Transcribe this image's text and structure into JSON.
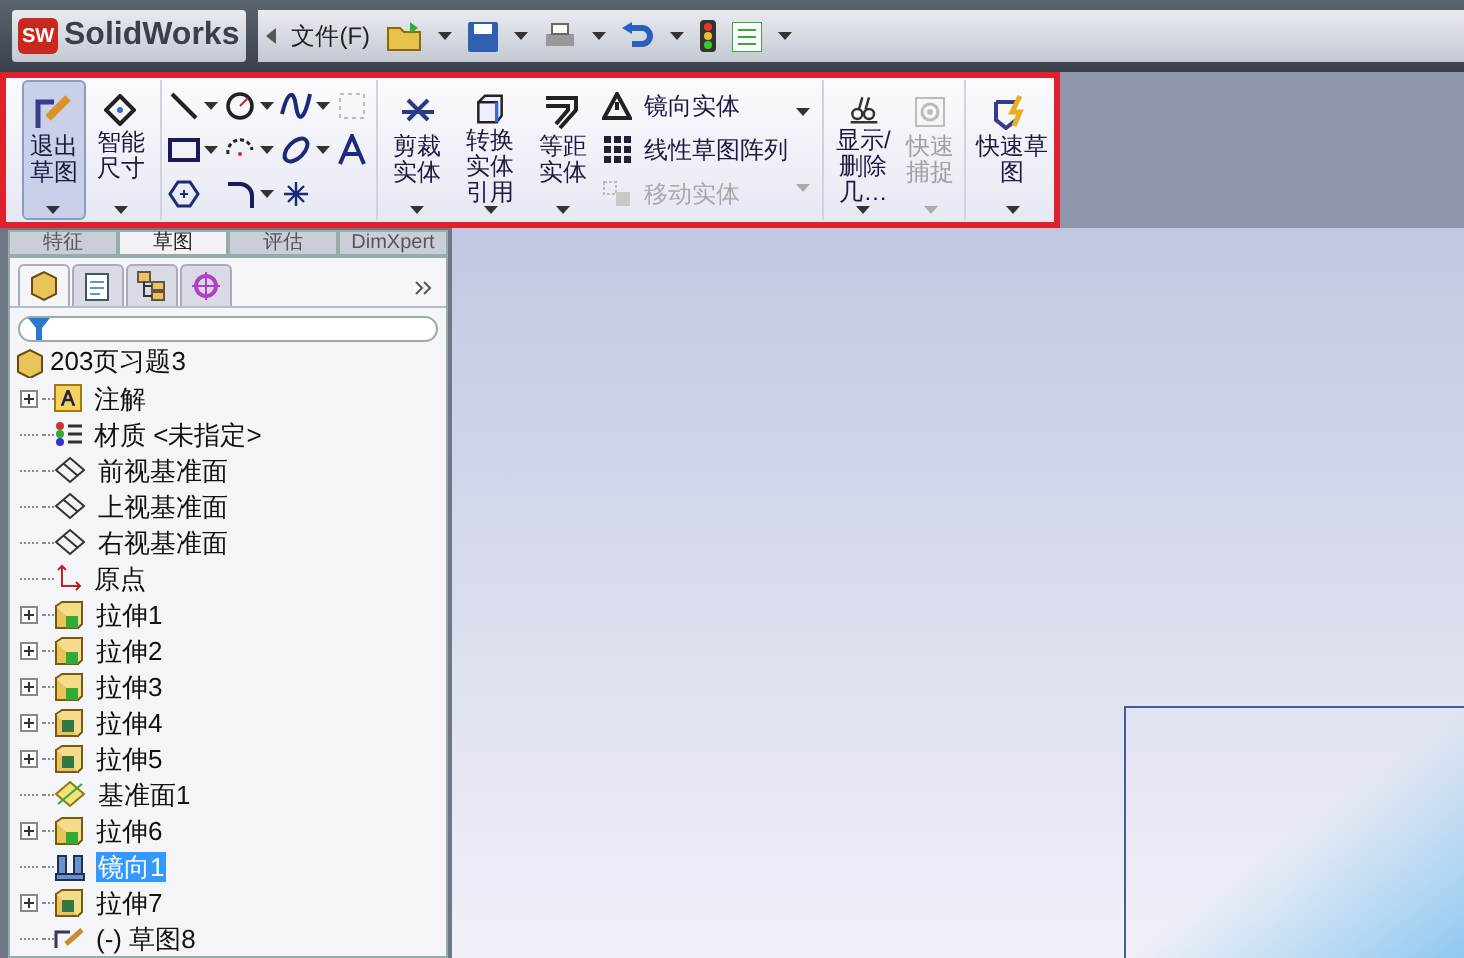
{
  "title_bar": {
    "logo_text": "SW",
    "app_name": "SolidWorks",
    "menu": "文件(F)"
  },
  "ribbon": {
    "main_buttons": [
      {
        "label": "退出草图",
        "selected": true
      },
      {
        "label": "智能尺寸",
        "selected": false
      }
    ],
    "edit_buttons": [
      {
        "label": "剪裁实体",
        "disabled": false
      },
      {
        "label": "转换实体引用",
        "disabled": false
      },
      {
        "label": "等距实体",
        "disabled": false
      }
    ],
    "list_commands": [
      {
        "label": "镜向实体",
        "disabled": false,
        "kind": "mirror"
      },
      {
        "label": "线性草图阵列",
        "disabled": false,
        "kind": "pattern"
      },
      {
        "label": "移动实体",
        "disabled": true,
        "kind": "move"
      }
    ],
    "end_buttons": [
      {
        "label": "显示/删除几…",
        "disabled": false,
        "kind": "relations"
      },
      {
        "label": "快速捕捉",
        "disabled": true,
        "kind": "snap"
      },
      {
        "label": "快速草图",
        "disabled": false,
        "kind": "quick"
      }
    ]
  },
  "tabs": [
    {
      "label": "特征",
      "selected": false
    },
    {
      "label": "草图",
      "selected": true
    },
    {
      "label": "评估",
      "selected": false
    },
    {
      "label": "DimXpert",
      "selected": false
    }
  ],
  "tree": {
    "root": "203页习题3",
    "items": [
      {
        "label": "注解",
        "kind": "annotation",
        "expandable": true,
        "selected": false
      },
      {
        "label": "材质 <未指定>",
        "kind": "material",
        "expandable": false,
        "selected": false
      },
      {
        "label": "前视基准面",
        "kind": "plane",
        "expandable": false,
        "selected": false
      },
      {
        "label": "上视基准面",
        "kind": "plane",
        "expandable": false,
        "selected": false
      },
      {
        "label": "右视基准面",
        "kind": "plane",
        "expandable": false,
        "selected": false
      },
      {
        "label": "原点",
        "kind": "origin",
        "expandable": false,
        "selected": false
      },
      {
        "label": "拉伸1",
        "kind": "boss",
        "expandable": true,
        "selected": false
      },
      {
        "label": "拉伸2",
        "kind": "boss",
        "expandable": true,
        "selected": false
      },
      {
        "label": "拉伸3",
        "kind": "boss",
        "expandable": true,
        "selected": false
      },
      {
        "label": "拉伸4",
        "kind": "cut",
        "expandable": true,
        "selected": false
      },
      {
        "label": "拉伸5",
        "kind": "cut",
        "expandable": true,
        "selected": false
      },
      {
        "label": "基准面1",
        "kind": "refplane",
        "expandable": false,
        "selected": false
      },
      {
        "label": "拉伸6",
        "kind": "boss",
        "expandable": true,
        "selected": false
      },
      {
        "label": "镜向1",
        "kind": "mirror",
        "expandable": false,
        "selected": true
      },
      {
        "label": "拉伸7",
        "kind": "cut",
        "expandable": true,
        "selected": false
      },
      {
        "label": "(-) 草图8",
        "kind": "sketch",
        "expandable": false,
        "selected": false
      }
    ]
  }
}
